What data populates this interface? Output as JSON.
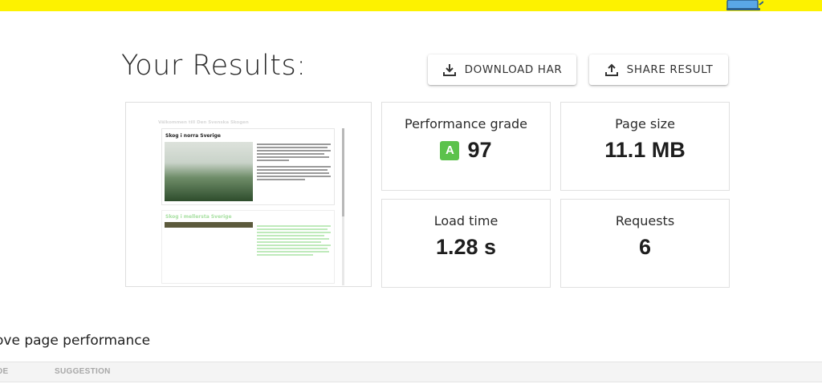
{
  "header": {
    "title": "Your Results:"
  },
  "actions": {
    "download_label": "DOWNLOAD HAR",
    "share_label": "SHARE RESULT"
  },
  "preview": {
    "site_header": "Välkommen till Den Svenska Skogen",
    "post1_title": "Skog i norra Sverige",
    "post2_title": "Skog i mellersta Sverige"
  },
  "metrics": {
    "performance": {
      "label": "Performance grade",
      "grade": "A",
      "score": "97"
    },
    "page_size": {
      "label": "Page size",
      "value": "11.1 MB"
    },
    "load_time": {
      "label": "Load time",
      "value": "1.28 s"
    },
    "requests": {
      "label": "Requests",
      "value": "6"
    }
  },
  "section": {
    "heading": "ove page performance"
  },
  "table": {
    "col_grade": "DE",
    "col_suggestion": "SUGGESTION"
  },
  "colors": {
    "topbar": "#fdf200",
    "grade_badge": "#5cc24c"
  },
  "icons": {
    "download": "download-icon",
    "share": "share-icon"
  }
}
